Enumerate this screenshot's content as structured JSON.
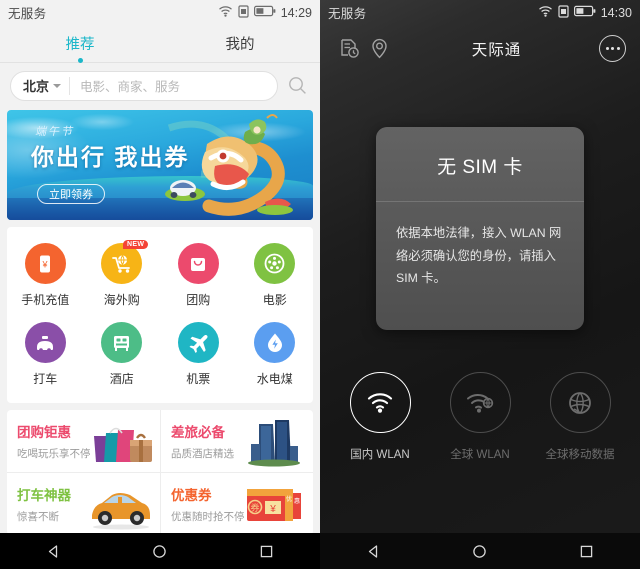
{
  "left_phone": {
    "status_bar": {
      "carrier": "无服务",
      "time": "14:29",
      "icons": [
        "wifi-icon",
        "sim-card-icon",
        "battery-icon"
      ]
    },
    "tabs": [
      {
        "label": "推荐",
        "active": true
      },
      {
        "label": "我的",
        "active": false
      }
    ],
    "search": {
      "city": "北京",
      "placeholder": "电影、商家、服务",
      "search_icon": "search-icon"
    },
    "banner": {
      "festival": "端午节",
      "headline": "你出行 我出券",
      "button": "立即领券",
      "artwork": "dragon-boat-illustration"
    },
    "grid": [
      {
        "label": "手机充值",
        "color": "#f4642f",
        "icon": "phone-recharge-icon",
        "badge": null
      },
      {
        "label": "海外购",
        "color": "#f7b416",
        "icon": "overseas-cart-icon",
        "badge": "NEW"
      },
      {
        "label": "团购",
        "color": "#ec4a6d",
        "icon": "shopping-bag-icon",
        "badge": null
      },
      {
        "label": "电影",
        "color": "#7fc242",
        "icon": "film-reel-icon",
        "badge": null
      },
      {
        "label": "打车",
        "color": "#8a4fa8",
        "icon": "taxi-icon",
        "badge": null
      },
      {
        "label": "酒店",
        "color": "#4dbd87",
        "icon": "hotel-bed-icon",
        "badge": null
      },
      {
        "label": "机票",
        "color": "#1fb6c4",
        "icon": "airplane-icon",
        "badge": null
      },
      {
        "label": "水电煤",
        "color": "#5b9ef0",
        "icon": "utility-drop-icon",
        "badge": null
      }
    ],
    "promos": [
      {
        "title": "团购钜惠",
        "subtitle": "吃喝玩乐享不停",
        "color": "#ec4a6d",
        "art": "shopping-bags-gift"
      },
      {
        "title": "差旅必备",
        "subtitle": "品质酒店精选",
        "color": "#ec4a6d",
        "art": "skyscrapers"
      },
      {
        "title": "打车神器",
        "subtitle": "惊喜不断",
        "color": "#7fc242",
        "art": "orange-car"
      },
      {
        "title": "优惠券",
        "subtitle": "优惠随时抢不停",
        "color": "#f4642f",
        "art": "coupon-stack"
      }
    ],
    "nav_bar": [
      "back-icon",
      "home-icon",
      "recents-icon"
    ]
  },
  "right_phone": {
    "status_bar": {
      "carrier": "无服务",
      "time": "14:30",
      "icons": [
        "wifi-icon",
        "sim-card-icon",
        "battery-icon"
      ]
    },
    "app_bar": {
      "history_icon": "order-history-icon",
      "location_icon": "location-pin-icon",
      "title": "天际通",
      "more_icon": "more-options-icon"
    },
    "dialog": {
      "title": "无 SIM 卡",
      "message": "依据本地法律，接入 WLAN 网络必须确认您的身份，请插入 SIM 卡。"
    },
    "modes": [
      {
        "label": "国内 WLAN",
        "icon": "wifi-icon",
        "selected": true
      },
      {
        "label": "全球 WLAN",
        "icon": "global-wifi-icon",
        "selected": false
      },
      {
        "label": "全球移动数据",
        "icon": "globe-data-icon",
        "selected": false
      }
    ],
    "nav_bar": [
      "back-icon",
      "home-icon",
      "recents-icon"
    ]
  }
}
